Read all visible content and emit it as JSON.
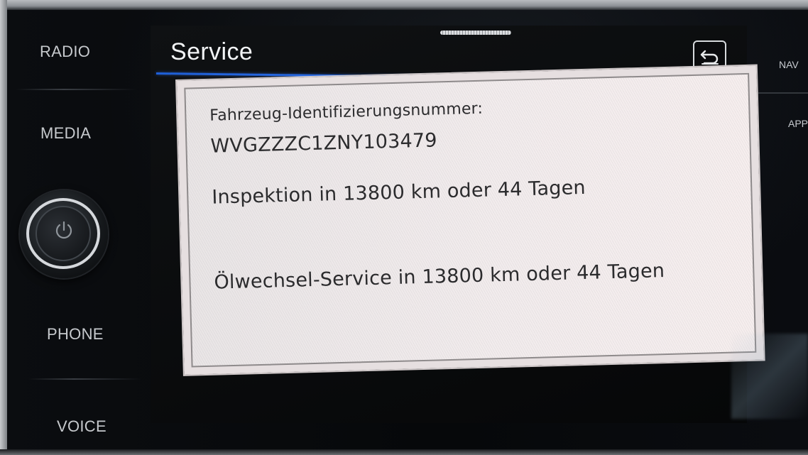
{
  "left_controls": {
    "radio_label": "RADIO",
    "media_label": "MEDIA",
    "phone_label": "PHONE",
    "voice_label": "VOICE"
  },
  "right_controls": {
    "nav_label": "NAV",
    "app_label": "APP"
  },
  "screen": {
    "title": "Service",
    "accent_color": "#2f6fe6",
    "back_icon": "back-arrow-icon"
  },
  "info": {
    "vin_label": "Fahrzeug-Identifizierungsnummer:",
    "vin_value": "WVGZZZC1ZNY103479",
    "inspection_text": "Inspektion in 13800 km oder 44 Tagen",
    "oil_service_text": "Ölwechsel-Service in 13800 km oder 44 Tagen"
  }
}
